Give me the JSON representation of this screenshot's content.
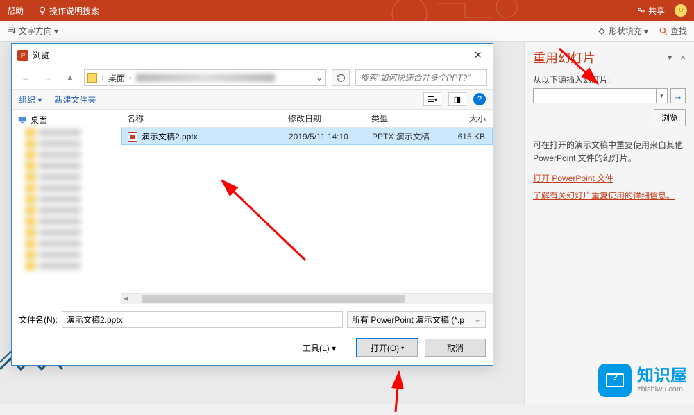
{
  "ribbon": {
    "help": "帮助",
    "tell_me": "操作说明搜索",
    "share": "共享"
  },
  "sub": {
    "text_dir": "文字方向",
    "shape_fill": "形状填充",
    "find": "查找"
  },
  "dialog": {
    "title": "浏览",
    "breadcrumb_root": "桌面",
    "search_placeholder": "搜索\"如何快速合并多个PPT?\"",
    "organize": "组织",
    "new_folder": "新建文件夹",
    "tree_root": "桌面",
    "columns": {
      "name": "名称",
      "date": "修改日期",
      "type": "类型",
      "size": "大小"
    },
    "file": {
      "name": "演示文稿2.pptx",
      "date": "2019/5/11 14:10",
      "type": "PPTX 演示文稿",
      "size": "615 KB"
    },
    "filename_label": "文件名(N):",
    "filename_value": "演示文稿2.pptx",
    "filter": "所有 PowerPoint 演示文稿 (*.p",
    "tools": "工具(L)",
    "open": "打开(O)",
    "cancel": "取消"
  },
  "panel": {
    "title": "重用幻灯片",
    "subtitle": "从以下源插入幻灯片:",
    "browse": "浏览",
    "desc": "可在打开的演示文稿中重复使用来自其他 PowerPoint 文件的幻灯片。",
    "link1": "打开 PowerPoint 文件",
    "link2": "了解有关幻灯片重复使用的详细信息。"
  },
  "watermark": {
    "title": "知识屋",
    "url": "zhishiwu.com"
  }
}
